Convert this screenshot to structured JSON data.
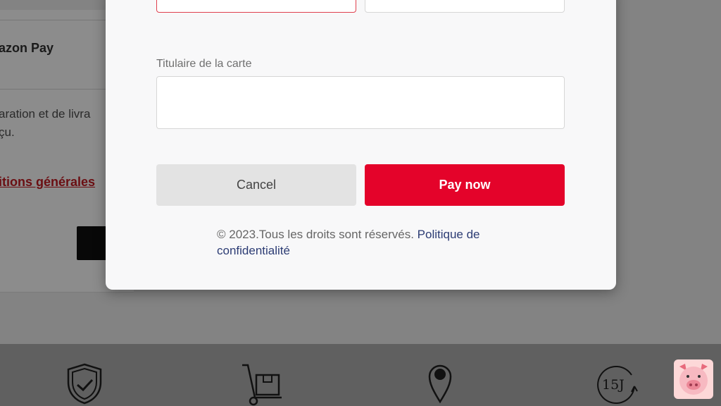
{
  "background": {
    "payment_option": "azon Pay",
    "info_line1": "aration et de livra",
    "info_line2": "çu.",
    "terms_link": "itions générales"
  },
  "modal": {
    "cardholder_label": "Titulaire de la carte",
    "cardholder_value": "",
    "cancel_label": "Cancel",
    "pay_label": "Pay now",
    "copyright_text": "© 2023.Tous les droits sont réservés.",
    "privacy_link": "Politique de confidentialité"
  },
  "footer": {
    "icons": [
      "shield-check-icon",
      "hand-truck-box-icon",
      "location-pin-icon",
      "15-days-return-icon"
    ],
    "return_days_text": "15J"
  },
  "colors": {
    "accent": "#e4032a",
    "link": "#2c3c74",
    "error_border": "#e0404e"
  }
}
